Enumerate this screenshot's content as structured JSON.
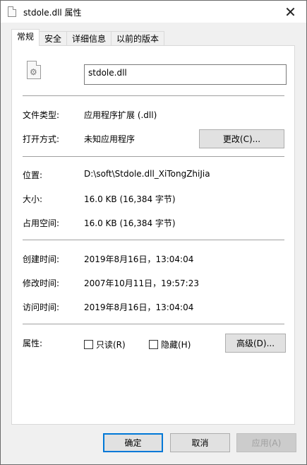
{
  "window": {
    "title": "stdole.dll 属性"
  },
  "tabs": [
    {
      "label": "常规"
    },
    {
      "label": "安全"
    },
    {
      "label": "详细信息"
    },
    {
      "label": "以前的版本"
    }
  ],
  "file": {
    "name": "stdole.dll",
    "icon": "dll-gear-icon"
  },
  "rows": {
    "type": {
      "label": "文件类型:",
      "value": "应用程序扩展 (.dll)"
    },
    "opens_with": {
      "label": "打开方式:",
      "value": "未知应用程序",
      "button": "更改(C)..."
    },
    "location": {
      "label": "位置:",
      "value": "D:\\soft\\Stdole.dll_XiTongZhiJia"
    },
    "size": {
      "label": "大小:",
      "value": "16.0 KB (16,384 字节)"
    },
    "size_on_disk": {
      "label": "占用空间:",
      "value": "16.0 KB (16,384 字节)"
    },
    "created": {
      "label": "创建时间:",
      "value": "2019年8月16日，13:04:04"
    },
    "modified": {
      "label": "修改时间:",
      "value": "2007年10月11日，19:57:23"
    },
    "accessed": {
      "label": "访问时间:",
      "value": "2019年8月16日，13:04:04"
    }
  },
  "attributes": {
    "label": "属性:",
    "readonly": {
      "label": "只读(R)",
      "checked": false
    },
    "hidden": {
      "label": "隐藏(H)",
      "checked": false
    },
    "advanced_button": "高级(D)..."
  },
  "buttons": {
    "ok": "确定",
    "cancel": "取消",
    "apply": "应用(A)"
  },
  "colors": {
    "default_button_border": "#0078d7",
    "disabled_text": "#a0a0a0"
  }
}
